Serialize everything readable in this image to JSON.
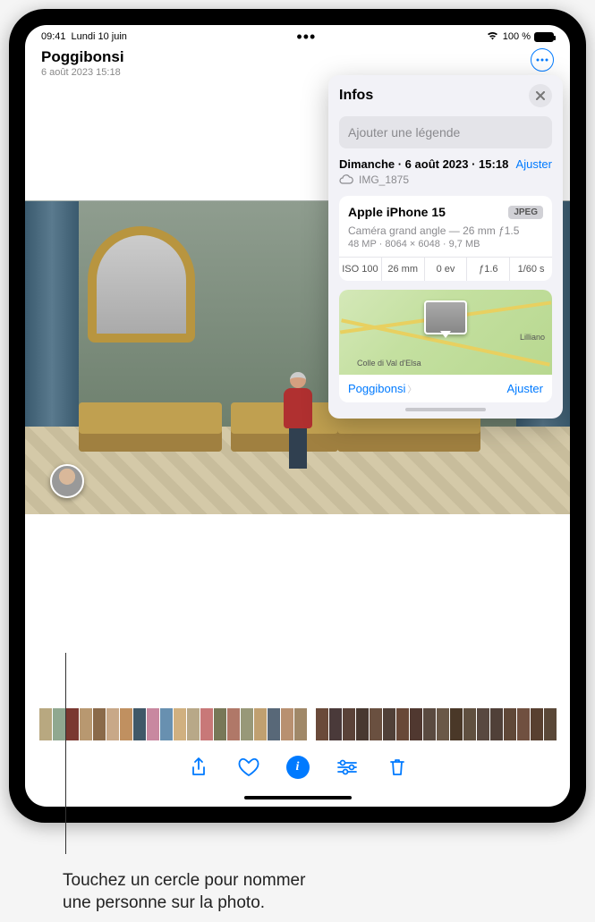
{
  "status": {
    "time": "09:41",
    "date": "Lundi 10 juin",
    "battery": "100 %"
  },
  "header": {
    "title": "Poggibonsi",
    "subtitle": "6 août 2023  15:18"
  },
  "info": {
    "title": "Infos",
    "caption_placeholder": "Ajouter une légende",
    "date_line": "Dimanche · 6 août 2023 · 15:18",
    "adjust": "Ajuster",
    "filename": "IMG_1875",
    "camera": {
      "model": "Apple iPhone 15",
      "badge": "JPEG",
      "lens": "Caméra grand angle — 26 mm ƒ1.5",
      "stats": "48 MP · 8064 × 6048 · 9,7 MB",
      "exif": {
        "iso": "ISO 100",
        "focal": "26 mm",
        "ev": "0 ev",
        "aperture": "ƒ1.6",
        "shutter": "1/60 s"
      }
    },
    "map": {
      "place1": "Colle di Val d'Elsa",
      "place2": "Lilliano",
      "location": "Poggibonsi",
      "adjust": "Ajuster"
    }
  },
  "callout": {
    "line1": "Touchez un cercle pour nommer",
    "line2": "une personne sur la photo."
  },
  "thumb_colors": [
    "#b8a880",
    "#90a890",
    "#7a3830",
    "#b89870",
    "#8a6a4a",
    "#c8a888",
    "#c09060",
    "#405868",
    "#c888a0",
    "#6890b0",
    "#d0b080",
    "#b8a888",
    "#c87878",
    "#787858",
    "#b07868",
    "#989878",
    "#c0a070",
    "#586878",
    "#b89070",
    "#a08868",
    "#6a4a3a",
    "#4a3a3a",
    "#5a4238",
    "#483830",
    "#6a5040",
    "#504038",
    "#684838",
    "#503830",
    "#5a4a40",
    "#6a5848",
    "#4a3828",
    "#605040",
    "#584840",
    "#504038",
    "#604838",
    "#705040",
    "#584030",
    "#5a4838"
  ]
}
